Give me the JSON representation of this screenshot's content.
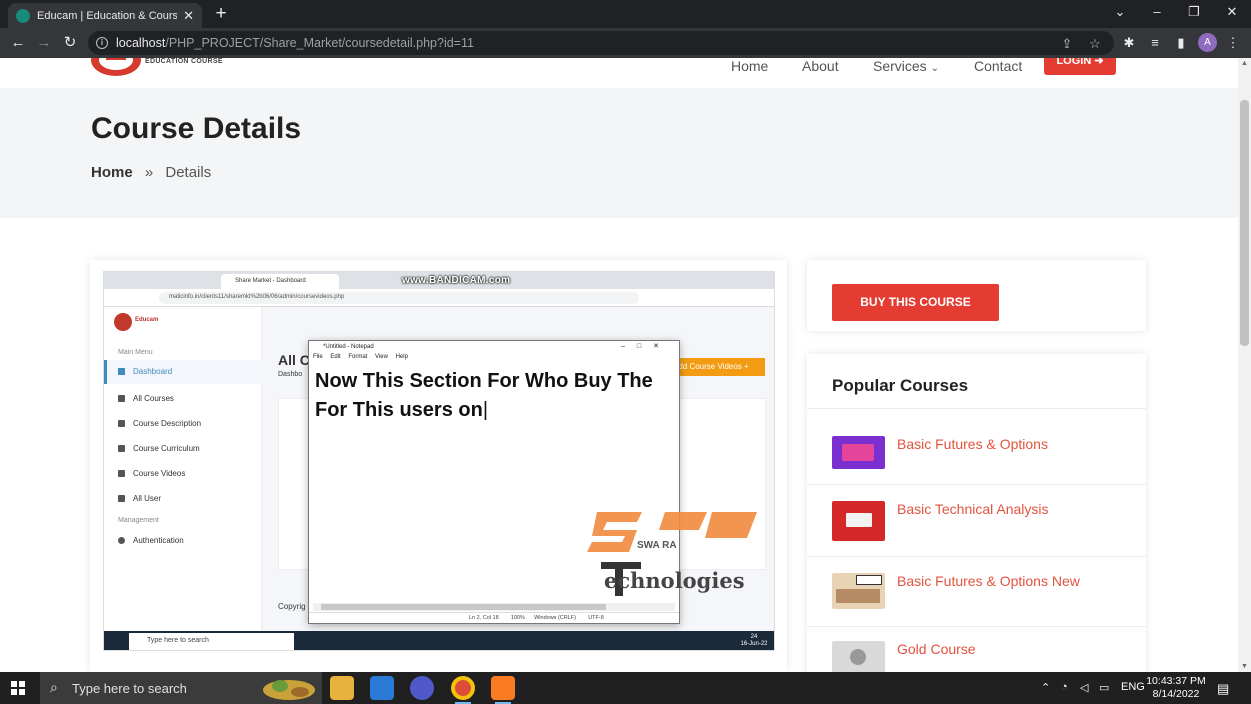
{
  "browser": {
    "tab_title": "Educam | Education & Courses.",
    "url_host": "localhost",
    "url_path": "/PHP_PROJECT/Share_Market/coursedetail.php?id=11",
    "profile_initial": "A"
  },
  "site": {
    "logo_text": "EDUCATION COURSE",
    "nav": [
      "Home",
      "About",
      "Services",
      "Contact"
    ],
    "login_label": "LOGIN"
  },
  "hero": {
    "title": "Course Details",
    "breadcrumb_home": "Home",
    "breadcrumb_sep": "»",
    "breadcrumb_current": "Details"
  },
  "video": {
    "watermark_recorder": "www.BANDICAM.com",
    "inner_tab_title": "Share Market - Dashboard",
    "inner_url": "maticinfo.in/clients11/sharemkt%2b06/06/admin/coursevideos.php",
    "inner_logo": "Educam",
    "sidebar_heading": "Main Menu",
    "sidebar_items": [
      "Dashboard",
      "All Courses",
      "Course Description",
      "Course Curriculum",
      "Course Videos",
      "All User"
    ],
    "sidebar_heading2": "Management",
    "sidebar_item_auth": "Authentication",
    "main_heading": "All C",
    "main_sub": "Dashbo",
    "add_btn": "Add Course Videos +",
    "footer_text": "Copyrig",
    "notepad_title": "*Untitled - Notepad",
    "notepad_menu": "File Edit Format View Help",
    "notepad_text_line1": "Now This Section For Who Buy The",
    "notepad_text_line2": "For This users on",
    "notepad_status": "Ln 2, Col 18        100%      Windows (CRLF)        UTF-8",
    "inner_search": "Type here to search",
    "inner_clock": "24\n16-Jun-22",
    "brand_watermark": "echnologies",
    "brand_watermark_letters": "SWA RA"
  },
  "sidebar": {
    "buy_label": "BUY THIS COURSE",
    "popular_title": "Popular Courses",
    "courses": [
      {
        "name": "Basic Futures & Options",
        "thumb_color": "#7b2fd0"
      },
      {
        "name": "Basic Technical Analysis",
        "thumb_color": "#d62828"
      },
      {
        "name": "Basic Futures & Options New",
        "thumb_color": "#e8d3b5"
      },
      {
        "name": "Gold Course",
        "thumb_color": "#d9d9d9"
      }
    ]
  },
  "taskbar": {
    "search_placeholder": "Type here to search",
    "language": "ENG",
    "time": "10:43:37 PM",
    "date": "8/14/2022"
  }
}
